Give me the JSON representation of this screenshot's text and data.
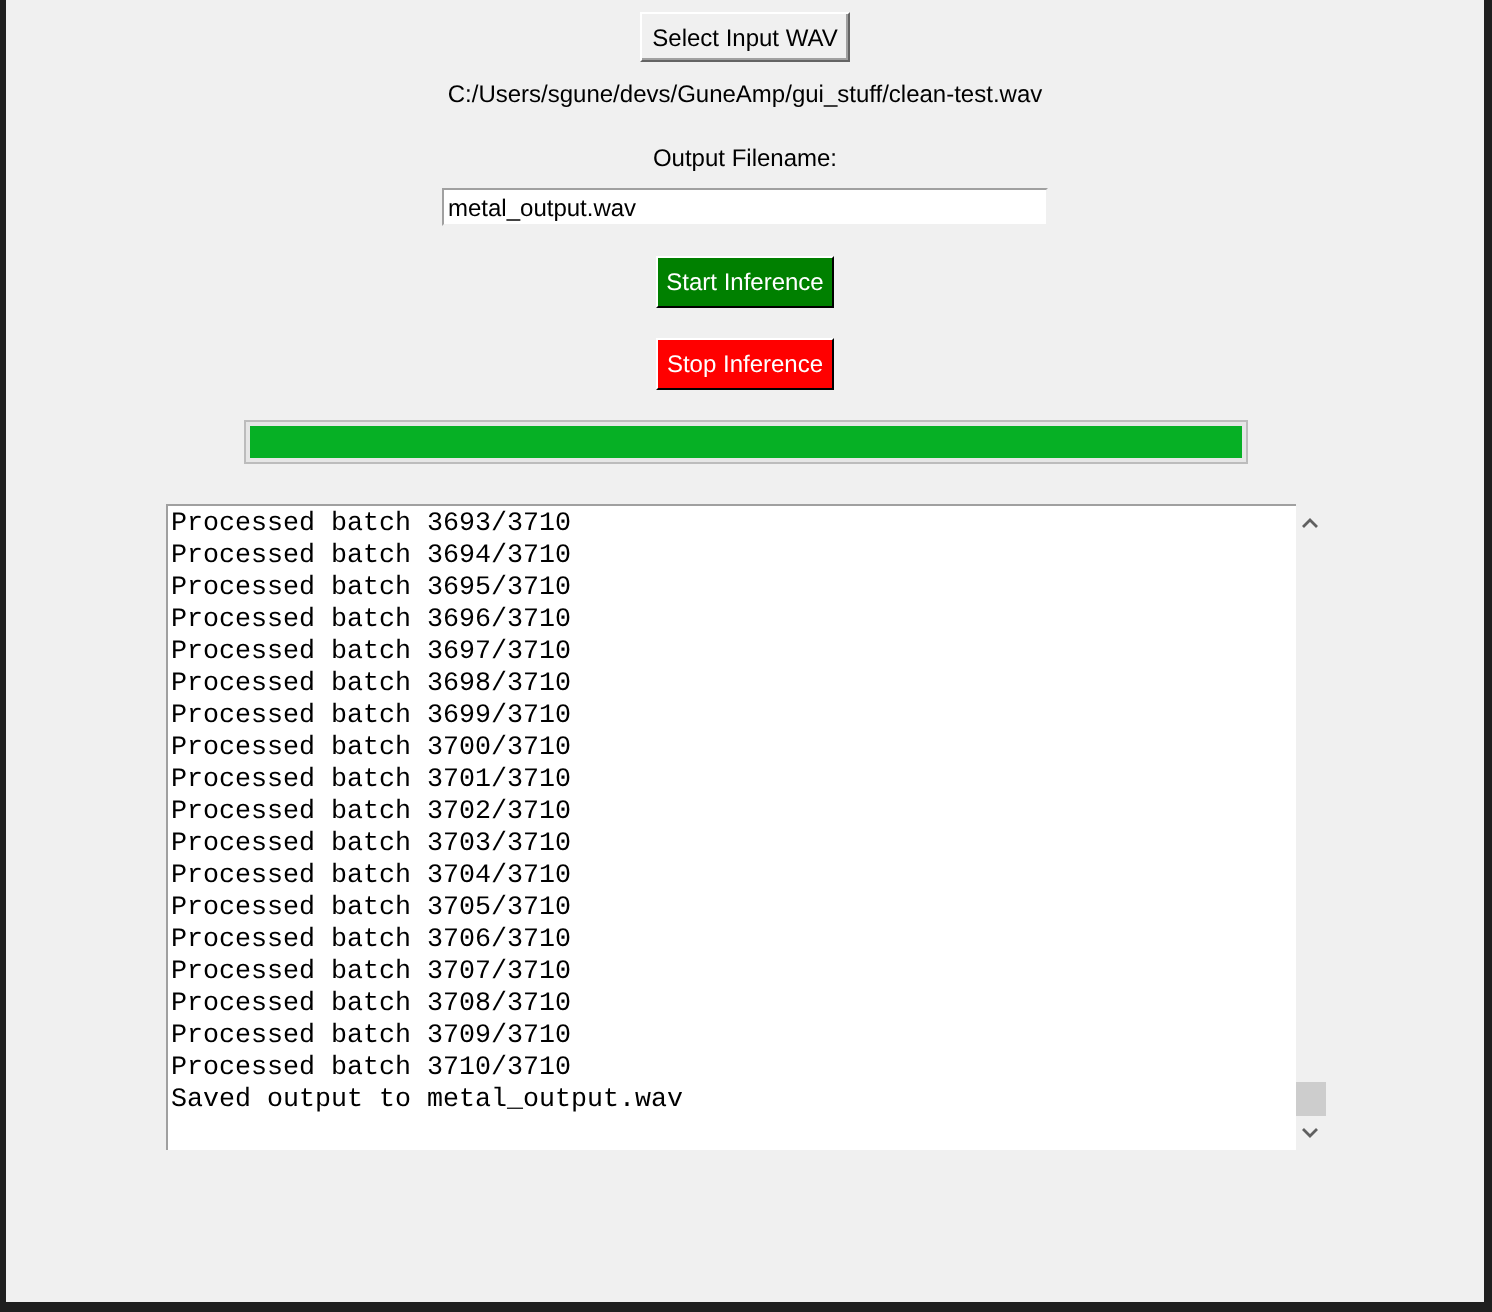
{
  "input_file": {
    "button": "Select Input WAV",
    "path": "C:/Users/sgune/devs/GuneAmp/gui_stuff/clean-test.wav"
  },
  "output_file": {
    "label": "Output Filename:",
    "value": "metal_output.wav"
  },
  "actions": [
    {
      "label": "Start Inference",
      "color": "#008000"
    },
    {
      "label": "Stop Inference",
      "color": "#ff0000"
    }
  ],
  "progress": {
    "level": 1
  },
  "log": {
    "lines": [
      "Processed batch 3693/3710",
      "Processed batch 3694/3710",
      "Processed batch 3695/3710",
      "Processed batch 3696/3710",
      "Processed batch 3697/3710",
      "Processed batch 3698/3710",
      "Processed batch 3699/3710",
      "Processed batch 3700/3710",
      "Processed batch 3701/3710",
      "Processed batch 3702/3710",
      "Processed batch 3703/3710",
      "Processed batch 3704/3710",
      "Processed batch 3705/3710",
      "Processed batch 3706/3710",
      "Processed batch 3707/3710",
      "Processed batch 3708/3710",
      "Processed batch 3709/3710",
      "Processed batch 3710/3710",
      "Saved output to metal_output.wav"
    ]
  }
}
